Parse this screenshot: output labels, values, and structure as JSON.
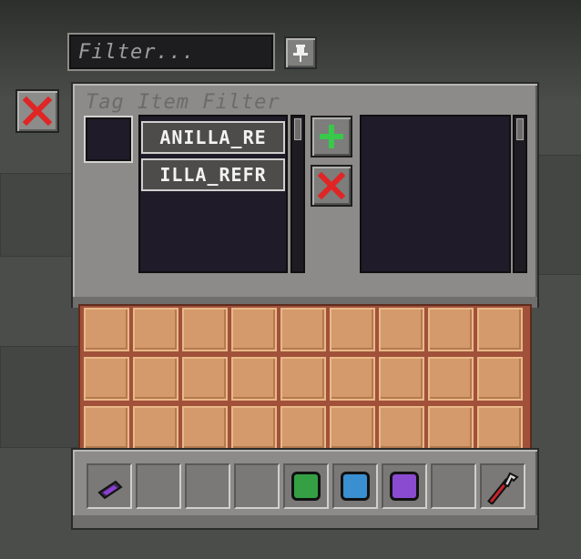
{
  "search": {
    "placeholder": "Filter..."
  },
  "window": {
    "title": "Tag Item Filter"
  },
  "tag_list": {
    "entries": [
      "ANILLA_RE",
      "ILLA_REFR"
    ]
  },
  "icons": {
    "pin": "pin-icon",
    "close": "close-x-icon",
    "add": "plus-icon",
    "remove": "remove-x-icon",
    "wrench": "wrench-icon"
  },
  "hotbar": {
    "slots": [
      {
        "item": "purple-tool-item"
      },
      {
        "item": ""
      },
      {
        "item": ""
      },
      {
        "item": ""
      },
      {
        "item": "green-gem",
        "color": "#34a043"
      },
      {
        "item": "blue-gem",
        "color": "#3a8fd0"
      },
      {
        "item": "purple-gem",
        "color": "#8a4bd0"
      },
      {
        "item": ""
      },
      {
        "item": "wrench"
      }
    ]
  },
  "colors": {
    "accent_red": "#e02525",
    "accent_green": "#38c94a",
    "panel": "#8c8b89",
    "slot_dark": "#201b29",
    "inventory_cell": "#d49a6b"
  }
}
